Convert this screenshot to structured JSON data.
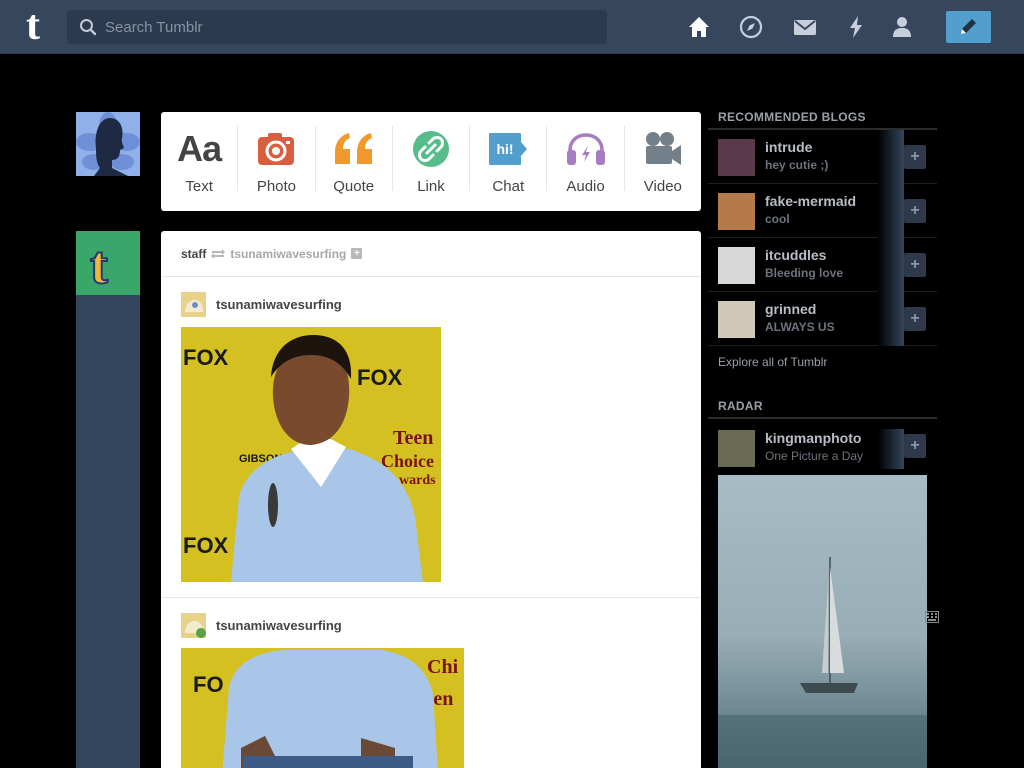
{
  "header": {
    "logo": "t",
    "search_placeholder": "Search Tumblr",
    "nav_icons": [
      "home-icon",
      "explore-icon",
      "inbox-icon",
      "activity-icon",
      "account-icon"
    ],
    "compose_icon": "pencil-icon"
  },
  "post_types": [
    {
      "label": "Text",
      "icon": "text-icon",
      "color": "#444444"
    },
    {
      "label": "Photo",
      "icon": "camera-icon",
      "color": "#d95e40"
    },
    {
      "label": "Quote",
      "icon": "quote-icon",
      "color": "#f2992e"
    },
    {
      "label": "Link",
      "icon": "link-icon",
      "color": "#56bc8a"
    },
    {
      "label": "Chat",
      "icon": "chat-icon",
      "color": "#529ecc"
    },
    {
      "label": "Audio",
      "icon": "headphones-icon",
      "color": "#a77dc2"
    },
    {
      "label": "Video",
      "icon": "video-camera-icon",
      "color": "#748089"
    }
  ],
  "post": {
    "author": "staff",
    "reblogged_from": "tsunamiwavesurfing",
    "trail": [
      {
        "name": "tsunamiwavesurfing"
      },
      {
        "name": "tsunamiwavesurfing"
      }
    ],
    "photo1_text": {
      "fox_a": "FOX",
      "fox_b": "FOX",
      "fox_c": "FOX",
      "teen": "Teen",
      "choice": "Choice",
      "awards": "wards",
      "gibson": "GIBSON"
    },
    "photo2_text": {
      "fox": "FO",
      "teen": "Teen",
      "chi": "Chi"
    }
  },
  "sidebar": {
    "recommended_title": "RECOMMENDED BLOGS",
    "blogs": [
      {
        "name": "intrude",
        "sub": "hey cutie ;)"
      },
      {
        "name": "fake-mermaid",
        "sub": "cool"
      },
      {
        "name": "itcuddles",
        "sub": "Bleeding love"
      },
      {
        "name": "grinned",
        "sub": "ALWAYS US"
      }
    ],
    "follow_label": "+",
    "explore_link": "Explore all of Tumblr",
    "radar_title": "RADAR",
    "radar_blog": {
      "name": "kingmanphoto",
      "sub": "One Picture a Day"
    }
  },
  "colors": {
    "header_bg": "#36465d",
    "accent_blue": "#529ecc",
    "staff_green": "#3aa66a"
  }
}
